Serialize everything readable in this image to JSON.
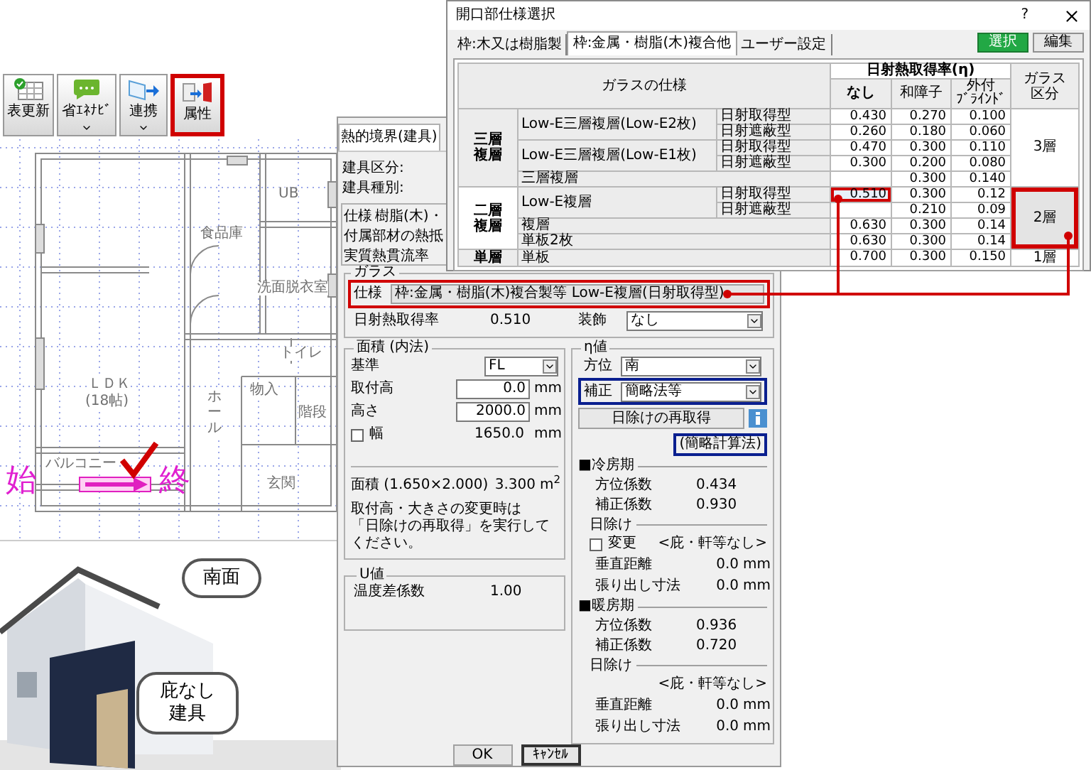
{
  "toolbar": [
    {
      "label": "表更新",
      "kind": "plain",
      "highlighted": false
    },
    {
      "label": "省ｴﾈﾅﾋﾞ",
      "kind": "menu",
      "highlighted": false
    },
    {
      "label": "連携",
      "kind": "menu",
      "highlighted": false
    },
    {
      "label": "属性",
      "kind": "plain",
      "highlighted": true
    }
  ],
  "floor_plan": {
    "rooms": [
      {
        "label": "UB",
        "kind": "horizontal"
      },
      {
        "label": "食品庫",
        "kind": "horizontal"
      },
      {
        "label": "洗面脱衣室",
        "kind": "horizontal"
      },
      {
        "label": "トイレ",
        "kind": "horizontal"
      },
      {
        "label": "ＬＤＫ",
        "kind": "horizontal"
      },
      {
        "label": "(18帖)",
        "kind": "horizontal"
      },
      {
        "label": "ホール",
        "kind": "vertical"
      },
      {
        "label": "物入",
        "kind": "horizontal"
      },
      {
        "label": "階段",
        "kind": "horizontal"
      },
      {
        "label": "バルコニー",
        "kind": "horizontal"
      },
      {
        "label": "玄関",
        "kind": "horizontal"
      }
    ],
    "start_label": "始",
    "end_label": "終"
  },
  "house_view": {
    "callouts": [
      {
        "lines": [
          "南面"
        ]
      },
      {
        "lines": [
          "庇なし",
          "建具"
        ]
      }
    ]
  },
  "thermal_dialog": {
    "title": "熱的境界(建具)",
    "fields": [
      "建具区分:",
      "建具種別:"
    ],
    "spec_rows": [
      {
        "label": "仕様",
        "value": "樹脂(木)・"
      },
      {
        "label": "付属部材の熱抵"
      },
      {
        "label": "実質熱貫流率"
      }
    ],
    "glass": {
      "title": "ガラス",
      "spec_label": "仕様",
      "spec_value": "枠:金属・樹脂(木)複合製等 Low-E複層(日射取得型)",
      "highlighted": true,
      "eta_label": "日射熱取得率",
      "eta_value": "0.510",
      "decoration_label": "装飾",
      "decoration_value": "なし"
    },
    "area": {
      "title": "面積 (内法)",
      "base_label": "基準",
      "base_value": "FL",
      "rows": [
        {
          "label": "取付高",
          "value": "0.0",
          "unit": "mm"
        },
        {
          "label": "高さ",
          "value": "2000.0",
          "unit": "mm"
        }
      ],
      "width": {
        "label": "幅",
        "checked": false,
        "value": "1650.0",
        "unit": "mm"
      },
      "area_label": "面積 (1.650×2.000)",
      "area_value": "3.300",
      "area_unit": "m$^{2}$",
      "note": [
        "取付高・大きさの変更時は",
        "「日除けの再取得」を実行してください。"
      ]
    },
    "u_value": {
      "title": "U値",
      "rows": [
        {
          "label": "温度差係数",
          "value": "1.00"
        }
      ]
    },
    "eta": {
      "title": "η値",
      "direction_label": "方位",
      "direction_value": "南",
      "correction_label": "補正",
      "correction_value": "簡略法等",
      "correction_highlighted": true,
      "reacquire_button": "日除けの再取得",
      "method": "(簡略計算法)",
      "method_highlighted": true,
      "periods": [
        {
          "title": "■冷房期",
          "rows": [
            {
              "label": "方位係数",
              "value": "0.434"
            },
            {
              "label": "補正係数",
              "value": "0.930"
            }
          ],
          "shade_title": "日除け",
          "change": {
            "label": "変更",
            "checked": false
          },
          "shade_status": "<庇・軒等なし>",
          "dims": [
            {
              "label": "垂直距離",
              "value": "0.0",
              "unit": "mm"
            },
            {
              "label": "張り出し寸法",
              "value": "0.0",
              "unit": "mm"
            }
          ]
        },
        {
          "title": "■暖房期",
          "rows": [
            {
              "label": "方位係数",
              "value": "0.936"
            },
            {
              "label": "補正係数",
              "value": "0.720"
            }
          ],
          "shade_title": "日除け",
          "shade_status": "<庇・軒等なし>",
          "dims": [
            {
              "label": "垂直距離",
              "value": "0.0",
              "unit": "mm"
            },
            {
              "label": "張り出し寸法",
              "value": "0.0",
              "unit": "mm"
            }
          ]
        }
      ]
    },
    "buttons": [
      {
        "label": "OK",
        "kind": "default"
      },
      {
        "label": "ｷｬﾝｾﾙ",
        "kind": "focused"
      }
    ]
  },
  "spec_dialog": {
    "title": "開口部仕様選択",
    "help": "?",
    "tabs": [
      {
        "label": "枠:木又は樹脂製",
        "selected": false
      },
      {
        "label": "枠:金属・樹脂(木)複合他",
        "selected": true
      },
      {
        "label": "ユーザー設定",
        "selected": false
      }
    ],
    "buttons": [
      {
        "label": "選択",
        "kind": "primary"
      },
      {
        "label": "編集",
        "kind": "normal"
      }
    ],
    "table": {
      "spec_header": "ガラスの仕様",
      "eta_header": "日射熱取得率(η)",
      "eta_columns": [
        [
          "なし"
        ],
        [
          "和障子"
        ],
        [
          "外付",
          "ﾌﾞﾗｲﾝﾄﾞ"
        ]
      ],
      "class_header": [
        "ガラス",
        "区分"
      ],
      "groups": [
        {
          "name": [
            "三層",
            "複層"
          ],
          "selected": false,
          "class": "3層",
          "specs": [
            {
              "name": "Low-E三層複層(Low-E2枚)",
              "types": [
                {
                  "name": "日射取得型",
                  "values": [
                    {
                      "text": "0.430",
                      "selected": false
                    },
                    {
                      "text": "0.270",
                      "selected": false
                    },
                    {
                      "text": "0.100",
                      "selected": false
                    }
                  ]
                },
                {
                  "name": "日射遮蔽型",
                  "values": [
                    {
                      "text": "0.260",
                      "selected": false
                    },
                    {
                      "text": "0.180",
                      "selected": false
                    },
                    {
                      "text": "0.060",
                      "selected": false
                    }
                  ]
                }
              ]
            },
            {
              "name": "Low-E三層複層(Low-E1枚)",
              "types": [
                {
                  "name": "日射取得型",
                  "values": [
                    {
                      "text": "0.470",
                      "selected": false
                    },
                    {
                      "text": "0.300",
                      "selected": false
                    },
                    {
                      "text": "0.110",
                      "selected": false
                    }
                  ]
                },
                {
                  "name": "日射遮蔽型",
                  "values": [
                    {
                      "text": "0.300",
                      "selected": false
                    },
                    {
                      "text": "0.200",
                      "selected": false
                    },
                    {
                      "text": "0.080",
                      "selected": false
                    }
                  ]
                }
              ]
            },
            {
              "name": "三層複層",
              "values": [
                {
                  "selected": false
                },
                {
                  "text": "0.300",
                  "selected": false
                },
                {
                  "text": "0.140",
                  "selected": false
                }
              ]
            }
          ]
        },
        {
          "name": [
            "二層",
            "複層"
          ],
          "selected": true,
          "class": "2層",
          "specs": [
            {
              "name": "Low-E複層",
              "types": [
                {
                  "name": "日射取得型",
                  "values": [
                    {
                      "text": "0.510",
                      "selected": true
                    },
                    {
                      "text": "0.300",
                      "selected": false
                    },
                    {
                      "text": "0.12",
                      "selected": false
                    }
                  ]
                },
                {
                  "name": "日射遮蔽型",
                  "values": [
                    {
                      "selected": false
                    },
                    {
                      "text": "0.210",
                      "selected": false
                    },
                    {
                      "text": "0.09",
                      "selected": false
                    }
                  ]
                }
              ]
            },
            {
              "name": "複層",
              "values": [
                {
                  "text": "0.630",
                  "selected": false
                },
                {
                  "text": "0.300",
                  "selected": false
                },
                {
                  "text": "0.14",
                  "selected": false
                }
              ]
            },
            {
              "name": "単板2枚",
              "values": [
                {
                  "text": "0.630",
                  "selected": false
                },
                {
                  "text": "0.300",
                  "selected": false
                },
                {
                  "text": "0.14",
                  "selected": false
                }
              ]
            }
          ]
        },
        {
          "name": [
            "単層"
          ],
          "selected": false,
          "class": "1層",
          "specs": [
            {
              "name": "単板",
              "values": [
                {
                  "text": "0.700",
                  "selected": false
                },
                {
                  "text": "0.300",
                  "selected": false
                },
                {
                  "text": "0.150",
                  "selected": false
                }
              ]
            }
          ]
        }
      ]
    }
  }
}
